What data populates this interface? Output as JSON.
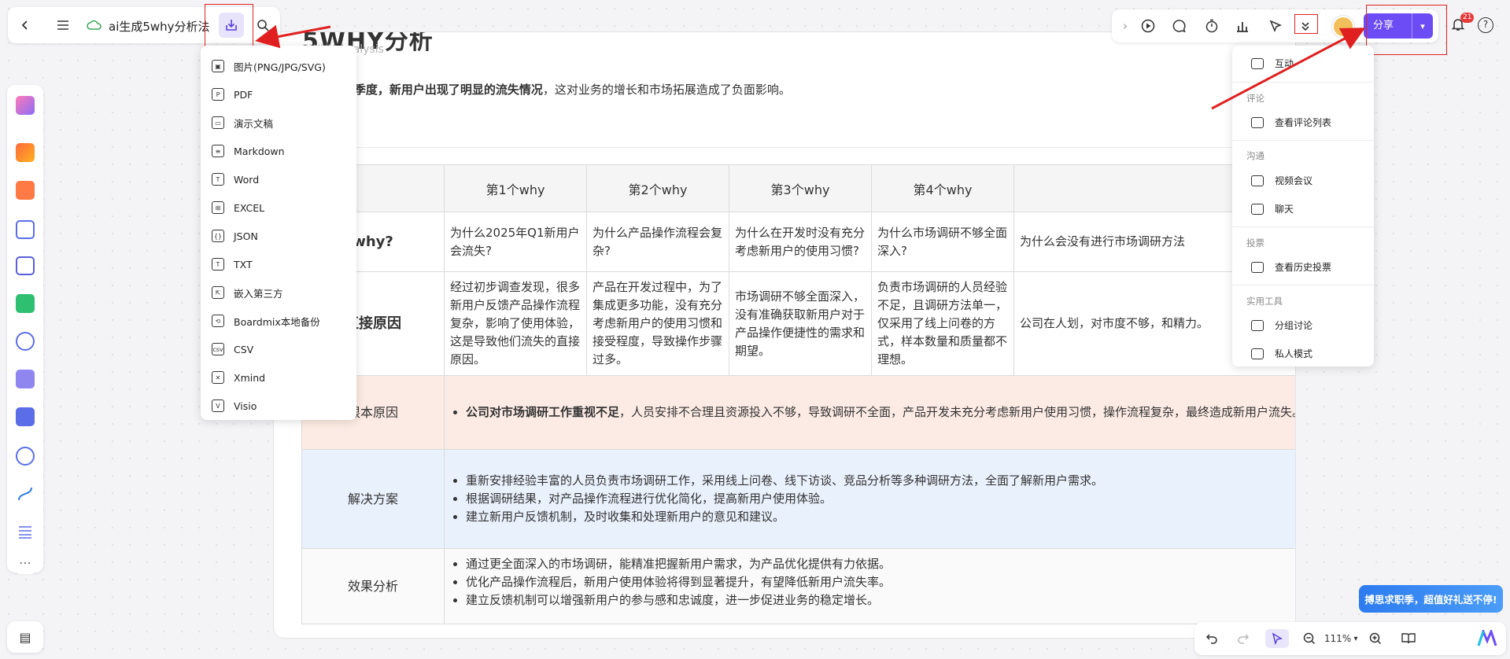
{
  "doc": {
    "title": "5WHY分析",
    "subtitle": "5WHY Analysis",
    "intro_bold": "25年第一季度，新用户出现了明显的流失情况",
    "intro_rest": "，这对业务的增长和市场拓展造成了负面影响。"
  },
  "table": {
    "headers": [
      "",
      "第1个why",
      "第2个why",
      "第3个why",
      "第4个why",
      ""
    ],
    "why_label": "why?",
    "why_cells": [
      "为什么2025年Q1新用户会流失?",
      "为什么产品操作流程会复杂?",
      "为什么在开发时没有充分考虑新用户的使用习惯?",
      "为什么市场调研不够全面深入?",
      "为什么会没有进行市场调研方法"
    ],
    "direct_label": "直接原因",
    "direct_cells": [
      "经过初步调查发现，很多新用户反馈产品操作流程复杂，影响了使用体验，这是导致他们流失的直接原因。",
      "产品在开发过程中，为了集成更多功能，没有充分考虑新用户的使用习惯和接受程度，导致操作步骤过多。",
      "市场调研不够全面深入，没有准确获取新用户对于产品操作便捷性的需求和期望。",
      "负责市场调研的人员经验不足，且调研方法单一，仅采用了线上问卷的方式，样本数量和质量都不理想。",
      "公司在人划，对市度不够，和精力。"
    ],
    "root_label": "根本原因",
    "root_bold": "公司对市场调研工作重视不足",
    "root_rest": "，人员安排不合理且资源投入不够，导致调研不全面，产品开发未充分考虑新用户使用习惯，操作流程复杂，最终造成新用户流失。",
    "solution_label": "解决方案",
    "solution_items": [
      "重新安排经验丰富的人员负责市场调研工作，采用线上问卷、线下访谈、竞品分析等多种调研方法，全面了解新用户需求。",
      "根据调研结果，对产品操作流程进行优化简化，提高新用户使用体验。",
      "建立新用户反馈机制，及时收集和处理新用户的意见和建议。"
    ],
    "effect_label": "效果分析",
    "effect_items": [
      "通过更全面深入的市场调研，能精准把握新用户需求，为产品优化提供有力依据。",
      "优化产品操作流程后，新用户使用体验将得到显著提升，有望降低新用户流失率。",
      "建立反馈机制可以增强新用户的参与感和忠诚度，进一步促进业务的稳定增长。"
    ]
  },
  "topbar": {
    "file_title": "ai生成5why分析法"
  },
  "export_menu": {
    "items": [
      "图片(PNG/JPG/SVG)",
      "PDF",
      "演示文稿",
      "Markdown",
      "Word",
      "EXCEL",
      "JSON",
      "TXT",
      "嵌入第三方",
      "Boardmix本地备份",
      "CSV",
      "Xmind",
      "Visio"
    ],
    "icon_glyphs": [
      "▣",
      "P",
      "▭",
      "≡",
      "T",
      "⊞",
      "{}",
      "T",
      "⇱",
      "⟲",
      "csv",
      "✕",
      "V"
    ]
  },
  "more_menu": {
    "interact": "互动",
    "sec_comment": "评论",
    "view_comments": "查看评论列表",
    "sec_comm": "沟通",
    "video": "视频会议",
    "chat": "聊天",
    "sec_vote": "投票",
    "vote_history": "查看历史投票",
    "sec_tools": "实用工具",
    "group": "分组讨论",
    "private": "私人模式"
  },
  "share": {
    "label": "分享"
  },
  "notifications": {
    "count": "21"
  },
  "zoom": {
    "value": "111%"
  },
  "promo": {
    "text": "搏思求职季，超值好礼送不停!"
  },
  "colors": {
    "accent": "#6c4df5",
    "root_bg": "#fcebe4",
    "solution_bg": "#e9f1fc",
    "annotation_red": "#e02020"
  }
}
